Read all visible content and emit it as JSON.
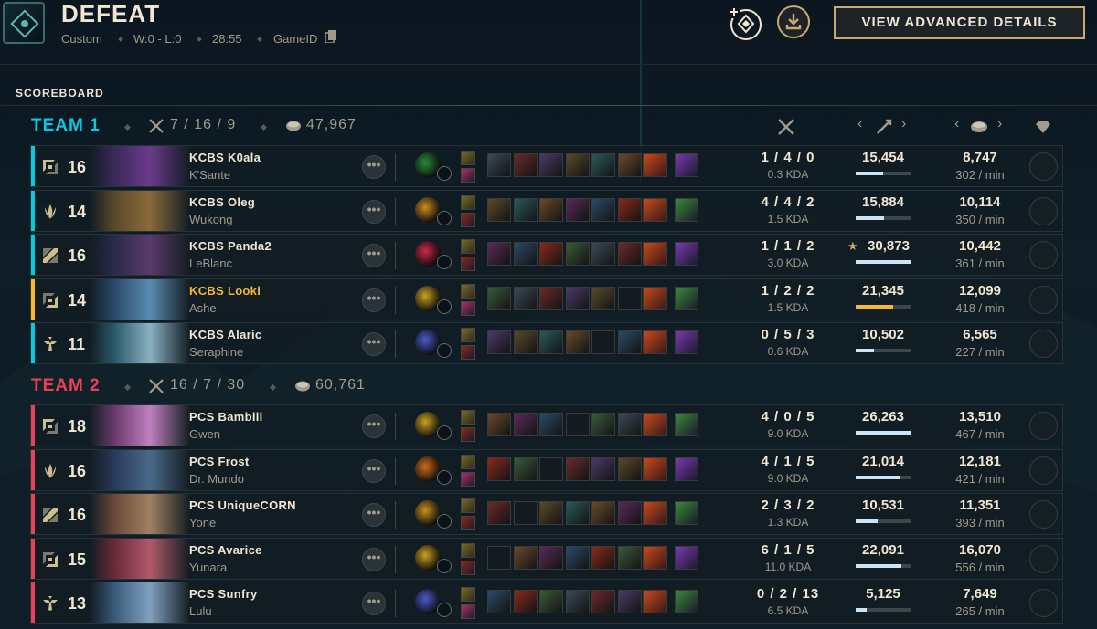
{
  "header": {
    "result": "DEFEAT",
    "queue": "Custom",
    "record": "W:0 - L:0",
    "duration": "28:55",
    "game_id_label": "GameID",
    "advanced_button": "VIEW ADVANCED DETAILS",
    "icons": [
      "game-mode-icon",
      "add-friend-icon",
      "download-icon",
      "copy-icon"
    ]
  },
  "scoreboard_label": "SCOREBOARD",
  "colors": {
    "team1": "#0ac8e0",
    "team2": "#e84057",
    "gold_text": "#f0e6d2",
    "accent": "#c8aa6e",
    "highlight": "#f5b82e"
  },
  "teams": [
    {
      "name": "TEAM 1",
      "kda": "7 / 16 / 9",
      "gold": "47,967",
      "players": [
        {
          "name": "KCBS K0ala",
          "champion": "K'Sante",
          "level": "16",
          "role": "top-icon",
          "kda": "1 / 4 / 0",
          "kda_ratio": "0.3 KDA",
          "damage": "15,454",
          "damage_ratio": 0.5,
          "gold": "8,747",
          "gold_per_min": "302 / min",
          "star": false,
          "highlight": false
        },
        {
          "name": "KCBS Oleg",
          "champion": "Wukong",
          "level": "14",
          "role": "jungle-icon",
          "kda": "4 / 4 / 2",
          "kda_ratio": "1.5 KDA",
          "damage": "15,884",
          "damage_ratio": 0.51,
          "gold": "10,114",
          "gold_per_min": "350 / min",
          "star": false,
          "highlight": false
        },
        {
          "name": "KCBS Panda2",
          "champion": "LeBlanc",
          "level": "16",
          "role": "mid-icon",
          "kda": "1 / 1 / 2",
          "kda_ratio": "3.0 KDA",
          "damage": "30,873",
          "damage_ratio": 1.0,
          "gold": "10,442",
          "gold_per_min": "361 / min",
          "star": true,
          "highlight": false
        },
        {
          "name": "KCBS Looki",
          "champion": "Ashe",
          "level": "14",
          "role": "bottom-icon",
          "kda": "1 / 2 / 2",
          "kda_ratio": "1.5 KDA",
          "damage": "21,345",
          "damage_ratio": 0.69,
          "gold": "12,099",
          "gold_per_min": "418 / min",
          "star": false,
          "highlight": true
        },
        {
          "name": "KCBS Alaric",
          "champion": "Seraphine",
          "level": "11",
          "role": "support-icon",
          "kda": "0 / 5 / 3",
          "kda_ratio": "0.6 KDA",
          "damage": "10,502",
          "damage_ratio": 0.34,
          "gold": "6,565",
          "gold_per_min": "227 / min",
          "star": false,
          "highlight": false
        }
      ]
    },
    {
      "name": "TEAM 2",
      "kda": "16 / 7 / 30",
      "gold": "60,761",
      "players": [
        {
          "name": "PCS Bambiii",
          "champion": "Gwen",
          "level": "18",
          "role": "top-icon",
          "kda": "4 / 0 / 5",
          "kda_ratio": "9.0 KDA",
          "damage": "26,263",
          "damage_ratio": 1.0,
          "gold": "13,510",
          "gold_per_min": "467 / min",
          "star": false,
          "highlight": false
        },
        {
          "name": "PCS Frost",
          "champion": "Dr. Mundo",
          "level": "16",
          "role": "jungle-icon",
          "kda": "4 / 1 / 5",
          "kda_ratio": "9.0 KDA",
          "damage": "21,014",
          "damage_ratio": 0.8,
          "gold": "12,181",
          "gold_per_min": "421 / min",
          "star": false,
          "highlight": false
        },
        {
          "name": "PCS UniqueCORN",
          "champion": "Yone",
          "level": "16",
          "role": "mid-icon",
          "kda": "2 / 3 / 2",
          "kda_ratio": "1.3 KDA",
          "damage": "10,531",
          "damage_ratio": 0.4,
          "gold": "11,351",
          "gold_per_min": "393 / min",
          "star": false,
          "highlight": false
        },
        {
          "name": "PCS Avarice",
          "champion": "Yunara",
          "level": "15",
          "role": "bottom-icon",
          "kda": "6 / 1 / 5",
          "kda_ratio": "11.0 KDA",
          "damage": "22,091",
          "damage_ratio": 0.84,
          "gold": "16,070",
          "gold_per_min": "556 / min",
          "star": false,
          "highlight": false
        },
        {
          "name": "PCS Sunfry",
          "champion": "Lulu",
          "level": "13",
          "role": "support-icon",
          "kda": "0 / 2 / 13",
          "kda_ratio": "6.5 KDA",
          "damage": "5,125",
          "damage_ratio": 0.2,
          "gold": "7,649",
          "gold_per_min": "265 / min",
          "star": false,
          "highlight": false
        }
      ]
    }
  ]
}
